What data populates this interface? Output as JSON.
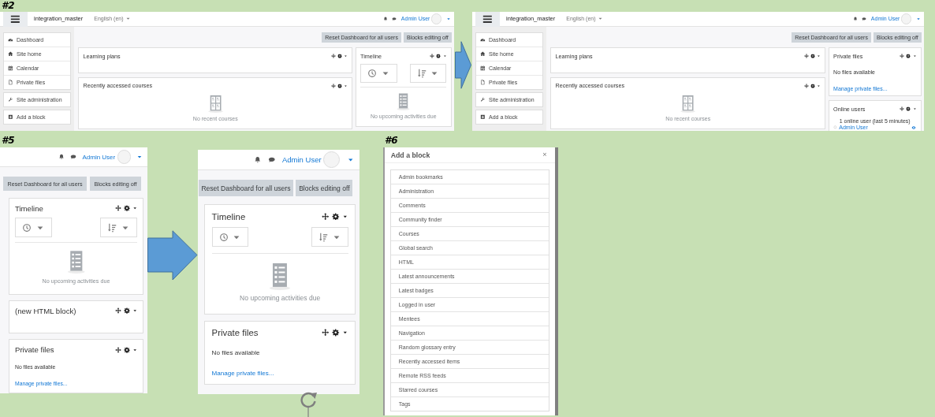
{
  "captions": [
    {
      "text": "#2"
    },
    {
      "text": "#5"
    },
    {
      "text": "#6"
    }
  ],
  "screens": [
    {
      "kind": "dashboard",
      "site_name": "integration_master",
      "language": "English (en)",
      "user": "Admin User",
      "nav_groups": [
        {
          "items": [
            {
              "kind": "dashboard",
              "label": "Dashboard"
            },
            {
              "kind": "home",
              "label": "Site home"
            },
            {
              "kind": "calendar",
              "label": "Calendar"
            },
            {
              "kind": "file",
              "label": "Private files"
            }
          ]
        },
        {
          "items": [
            {
              "kind": "admin",
              "label": "Site administration"
            }
          ]
        },
        {
          "items": [
            {
              "kind": "add",
              "label": "Add a block"
            }
          ]
        }
      ],
      "buttons": [
        "Reset Dashboard for all users",
        "Blocks editing off"
      ],
      "main_blocks": [
        {
          "kind": "plain",
          "title": "Learning plans"
        },
        {
          "kind": "courses",
          "title": "Recently accessed courses",
          "empty_text": "No recent courses"
        }
      ],
      "side_blocks": [
        {
          "kind": "timeline",
          "title": "Timeline",
          "empty_text": "No upcoming activities due"
        }
      ]
    },
    {
      "kind": "dashboard",
      "site_name": "integration_master",
      "language": "English (en)",
      "user": "Admin User",
      "nav_groups": [
        {
          "items": [
            {
              "kind": "dashboard",
              "label": "Dashboard"
            },
            {
              "kind": "home",
              "label": "Site home"
            },
            {
              "kind": "calendar",
              "label": "Calendar"
            },
            {
              "kind": "file",
              "label": "Private files"
            }
          ]
        },
        {
          "items": [
            {
              "kind": "admin",
              "label": "Site administration"
            }
          ]
        },
        {
          "items": [
            {
              "kind": "add",
              "label": "Add a block"
            }
          ]
        }
      ],
      "buttons": [
        "Reset Dashboard for all users",
        "Blocks editing off"
      ],
      "main_blocks": [
        {
          "kind": "plain",
          "title": "Learning plans"
        },
        {
          "kind": "courses",
          "title": "Recently accessed courses",
          "empty_text": "No recent courses"
        }
      ],
      "side_blocks": [
        {
          "kind": "files",
          "title": "Private files",
          "text": "No files available",
          "link": "Manage private files..."
        },
        {
          "kind": "online",
          "title": "Online users",
          "summary": "1 online user (last 5 minutes)",
          "users": [
            {
              "name": "Admin User"
            }
          ]
        }
      ]
    },
    {
      "kind": "dashboard",
      "user": "Admin User",
      "buttons": [
        "Reset Dashboard for all users",
        "Blocks editing off"
      ],
      "side_blocks": [
        {
          "kind": "timeline",
          "title": "Timeline",
          "empty_text": "No upcoming activities due"
        },
        {
          "kind": "plain",
          "title": "(new HTML block)"
        },
        {
          "kind": "files",
          "title": "Private files",
          "text": "No files available",
          "link": "Manage private files..."
        }
      ]
    },
    {
      "kind": "dashboard",
      "user": "Admin User",
      "buttons": [
        "Reset Dashboard for all users",
        "Blocks editing off"
      ],
      "side_blocks": [
        {
          "kind": "timeline",
          "title": "Timeline",
          "empty_text": "No upcoming activities due"
        },
        {
          "kind": "files",
          "title": "Private files",
          "text": "No files available",
          "link": "Manage private files..."
        }
      ]
    },
    {
      "kind": "modal",
      "title": "Add a block",
      "close": "×",
      "items": [
        "Admin bookmarks",
        "Administration",
        "Comments",
        "Community finder",
        "Courses",
        "Global search",
        "HTML",
        "Latest announcements",
        "Latest badges",
        "Logged in user",
        "Mentees",
        "Navigation",
        "Random glossary entry",
        "Recently accessed items",
        "Remote RSS feeds",
        "Starred courses",
        "Tags"
      ]
    }
  ]
}
